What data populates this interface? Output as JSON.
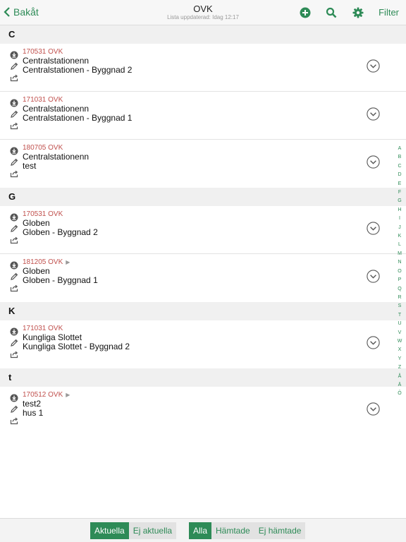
{
  "topbar": {
    "back_label": "Bakåt",
    "title": "OVK",
    "subtitle": "Lista uppdaterad: Idag 12:17",
    "filter_label": "Filter",
    "accent": "#2e8b57"
  },
  "sections": [
    {
      "letter": "C",
      "items": [
        {
          "code": "170531 OVK",
          "line1": "Centralstationenn",
          "line2": "Centralstationen - Byggnad 2",
          "flag": ""
        },
        {
          "code": "171031 OVK",
          "line1": "Centralstationenn",
          "line2": "Centralstationen - Byggnad 1",
          "flag": ""
        },
        {
          "code": "180705 OVK",
          "line1": "Centralstationenn",
          "line2": "test",
          "flag": ""
        }
      ]
    },
    {
      "letter": "G",
      "items": [
        {
          "code": "170531 OVK",
          "line1": "Globen",
          "line2": "Globen - Byggnad 2",
          "flag": ""
        },
        {
          "code": "181205 OVK",
          "line1": "Globen",
          "line2": "Globen - Byggnad 1",
          "flag": "▶"
        }
      ]
    },
    {
      "letter": "K",
      "items": [
        {
          "code": "171031 OVK",
          "line1": "Kungliga Slottet",
          "line2": "Kungliga Slottet - Byggnad 2",
          "flag": ""
        }
      ]
    },
    {
      "letter": "t",
      "items": [
        {
          "code": "170512 OVK",
          "line1": "test2",
          "line2": "hus 1",
          "flag": "▶"
        }
      ]
    }
  ],
  "alphabet": [
    "A",
    "B",
    "C",
    "D",
    "E",
    "F",
    "G",
    "H",
    "I",
    "J",
    "K",
    "L",
    "M",
    "N",
    "O",
    "P",
    "Q",
    "R",
    "S",
    "T",
    "U",
    "V",
    "W",
    "X",
    "Y",
    "Z",
    "Å",
    "Ä",
    "Ö"
  ],
  "bottombar": {
    "group1": [
      {
        "label": "Aktuella",
        "active": true
      },
      {
        "label": "Ej aktuella",
        "active": false
      }
    ],
    "group2": [
      {
        "label": "Alla",
        "active": true
      },
      {
        "label": "Hämtade",
        "active": false
      },
      {
        "label": "Ej hämtade",
        "active": false
      }
    ]
  },
  "icons": {
    "row_icons": [
      "download-circle-icon",
      "pencil-icon",
      "share-icon"
    ],
    "toolbar": [
      "add-circle-icon",
      "search-icon",
      "gear-icon"
    ],
    "chevron": "chevron-down-circle-icon"
  }
}
